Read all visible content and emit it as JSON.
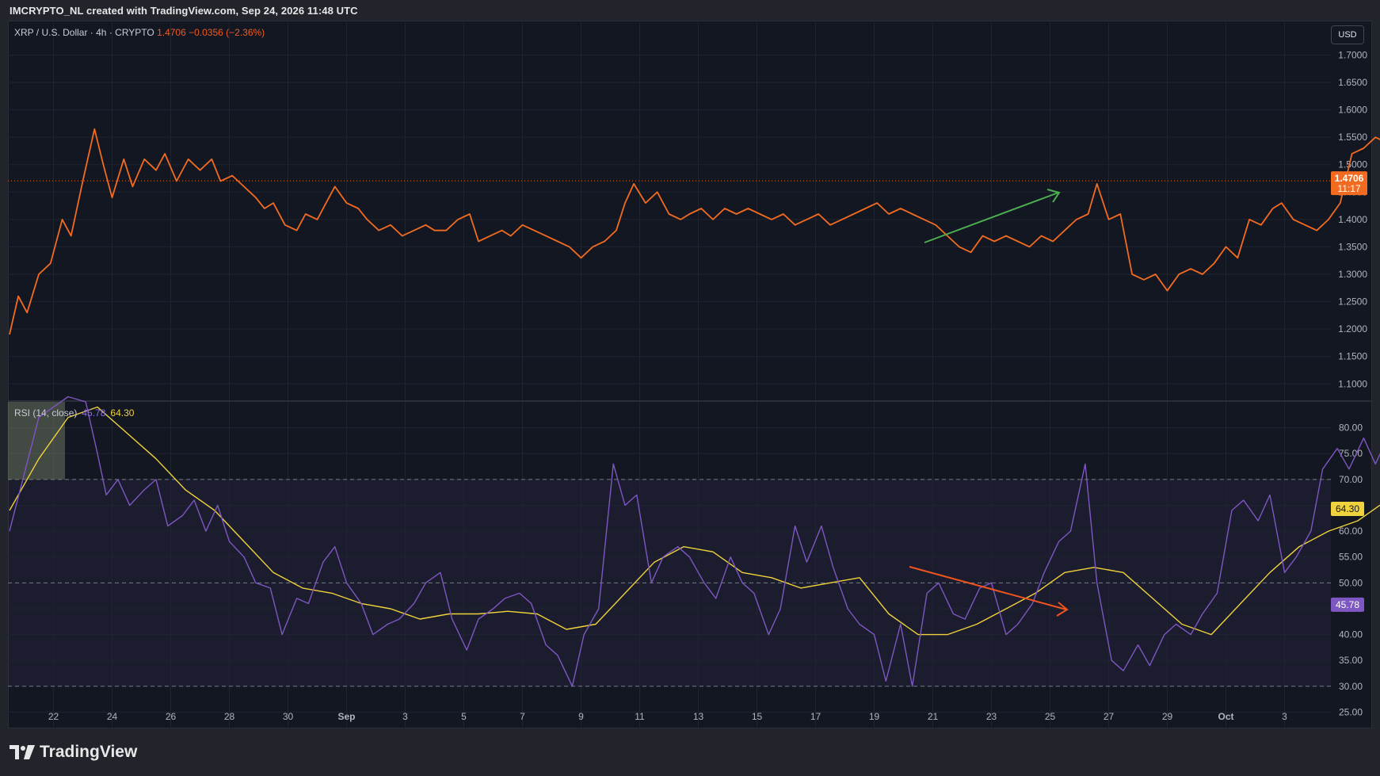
{
  "header": {
    "credit": "IMCRYPTO_NL created with TradingView.com, Sep 24, 2026 11:48 UTC",
    "symbol": "XRP / U.S. Dollar · 4h · CRYPTO",
    "last": "1.4706",
    "change": "−0.0356 (−2.36%)",
    "currency": "USD"
  },
  "rsi_header": {
    "label": "RSI (14, close)",
    "rsi_value": "45.78",
    "ma_value": "64.30"
  },
  "price_tag": {
    "price": "1.4706",
    "countdown": "11:17"
  },
  "brand": {
    "name": "TradingView"
  },
  "colors": {
    "price_line": "#f26b21",
    "rsi_line": "#7e57c2",
    "rsi_ma": "#f0d23c",
    "up_arrow": "#4caf50",
    "down_arrow": "#f0541e",
    "background": "#131722"
  },
  "chart_data": [
    {
      "type": "line",
      "name": "price",
      "ylim": [
        1.07,
        1.76
      ],
      "yticks": [
        "1.7000",
        "1.6500",
        "1.6000",
        "1.5500",
        "1.5000",
        "1.4500",
        "1.4000",
        "1.3500",
        "1.3000",
        "1.2500",
        "1.2000",
        "1.1500",
        "1.1000"
      ],
      "x_ticks": [
        "22",
        "24",
        "26",
        "28",
        "30",
        "Sep",
        "3",
        "5",
        "7",
        "9",
        "11",
        "13",
        "15",
        "17",
        "19",
        "21",
        "23",
        "25",
        "27",
        "29",
        "Oct",
        "3"
      ],
      "x_range": [
        0,
        44.5
      ],
      "points": [
        [
          0,
          1.19
        ],
        [
          0.3,
          1.26
        ],
        [
          0.6,
          1.23
        ],
        [
          1.0,
          1.3
        ],
        [
          1.4,
          1.32
        ],
        [
          1.8,
          1.4
        ],
        [
          2.1,
          1.37
        ],
        [
          2.5,
          1.47
        ],
        [
          2.9,
          1.565
        ],
        [
          3.2,
          1.5
        ],
        [
          3.5,
          1.44
        ],
        [
          3.9,
          1.51
        ],
        [
          4.2,
          1.46
        ],
        [
          4.6,
          1.51
        ],
        [
          5.0,
          1.49
        ],
        [
          5.3,
          1.52
        ],
        [
          5.7,
          1.47
        ],
        [
          6.1,
          1.51
        ],
        [
          6.5,
          1.49
        ],
        [
          6.9,
          1.51
        ],
        [
          7.2,
          1.47
        ],
        [
          7.6,
          1.48
        ],
        [
          8.0,
          1.46
        ],
        [
          8.4,
          1.44
        ],
        [
          8.7,
          1.42
        ],
        [
          9.0,
          1.43
        ],
        [
          9.4,
          1.39
        ],
        [
          9.8,
          1.38
        ],
        [
          10.1,
          1.41
        ],
        [
          10.5,
          1.4
        ],
        [
          10.8,
          1.43
        ],
        [
          11.1,
          1.46
        ],
        [
          11.5,
          1.43
        ],
        [
          11.9,
          1.42
        ],
        [
          12.2,
          1.4
        ],
        [
          12.6,
          1.38
        ],
        [
          13.0,
          1.39
        ],
        [
          13.4,
          1.37
        ],
        [
          13.8,
          1.38
        ],
        [
          14.2,
          1.39
        ],
        [
          14.5,
          1.38
        ],
        [
          14.9,
          1.38
        ],
        [
          15.3,
          1.4
        ],
        [
          15.7,
          1.41
        ],
        [
          16.0,
          1.36
        ],
        [
          16.4,
          1.37
        ],
        [
          16.8,
          1.38
        ],
        [
          17.1,
          1.37
        ],
        [
          17.5,
          1.39
        ],
        [
          17.9,
          1.38
        ],
        [
          18.3,
          1.37
        ],
        [
          18.7,
          1.36
        ],
        [
          19.1,
          1.35
        ],
        [
          19.5,
          1.33
        ],
        [
          19.9,
          1.35
        ],
        [
          20.3,
          1.36
        ],
        [
          20.7,
          1.38
        ],
        [
          21.0,
          1.43
        ],
        [
          21.3,
          1.465
        ],
        [
          21.7,
          1.43
        ],
        [
          22.1,
          1.45
        ],
        [
          22.5,
          1.41
        ],
        [
          22.9,
          1.4
        ],
        [
          23.2,
          1.41
        ],
        [
          23.6,
          1.42
        ],
        [
          24.0,
          1.4
        ],
        [
          24.4,
          1.42
        ],
        [
          24.8,
          1.41
        ],
        [
          25.2,
          1.42
        ],
        [
          25.6,
          1.41
        ],
        [
          26.0,
          1.4
        ],
        [
          26.4,
          1.41
        ],
        [
          26.8,
          1.39
        ],
        [
          27.2,
          1.4
        ],
        [
          27.6,
          1.41
        ],
        [
          28.0,
          1.39
        ],
        [
          28.4,
          1.4
        ],
        [
          28.8,
          1.41
        ],
        [
          29.2,
          1.42
        ],
        [
          29.6,
          1.43
        ],
        [
          30.0,
          1.41
        ],
        [
          30.4,
          1.42
        ],
        [
          30.8,
          1.41
        ],
        [
          31.2,
          1.4
        ],
        [
          31.6,
          1.39
        ],
        [
          32.0,
          1.37
        ],
        [
          32.4,
          1.35
        ],
        [
          32.8,
          1.34
        ],
        [
          33.2,
          1.37
        ],
        [
          33.6,
          1.36
        ],
        [
          34.0,
          1.37
        ],
        [
          34.4,
          1.36
        ],
        [
          34.8,
          1.35
        ],
        [
          35.2,
          1.37
        ],
        [
          35.6,
          1.36
        ],
        [
          36.0,
          1.38
        ],
        [
          36.4,
          1.4
        ],
        [
          36.8,
          1.41
        ],
        [
          37.1,
          1.465
        ],
        [
          37.5,
          1.4
        ],
        [
          37.9,
          1.41
        ],
        [
          38.3,
          1.3
        ],
        [
          38.7,
          1.29
        ],
        [
          39.1,
          1.3
        ],
        [
          39.5,
          1.27
        ],
        [
          39.9,
          1.3
        ],
        [
          40.3,
          1.31
        ],
        [
          40.7,
          1.3
        ],
        [
          41.1,
          1.32
        ],
        [
          41.5,
          1.35
        ],
        [
          41.9,
          1.33
        ],
        [
          42.3,
          1.4
        ],
        [
          42.7,
          1.39
        ],
        [
          43.1,
          1.42
        ],
        [
          43.4,
          1.43
        ],
        [
          43.8,
          1.4
        ],
        [
          44.2,
          1.39
        ],
        [
          44.6,
          1.38
        ],
        [
          45.0,
          1.4
        ],
        [
          45.4,
          1.43
        ],
        [
          45.8,
          1.52
        ],
        [
          46.2,
          1.53
        ],
        [
          46.6,
          1.55
        ],
        [
          47.0,
          1.54
        ],
        [
          47.3,
          1.59
        ],
        [
          47.7,
          1.57
        ],
        [
          48.1,
          1.62
        ],
        [
          48.5,
          1.58
        ],
        [
          48.9,
          1.51
        ],
        [
          49.3,
          1.5
        ],
        [
          49.7,
          1.505
        ],
        [
          50.0,
          1.49
        ],
        [
          50.3,
          1.4706
        ]
      ]
    },
    {
      "type": "line",
      "name": "RSI (14, close)",
      "ylim": [
        22,
        85
      ],
      "yticks": [
        "80.00",
        "75.00",
        "70.00",
        "65.00",
        "60.00",
        "55.00",
        "50.00",
        "45.00",
        "40.00",
        "35.00",
        "30.00",
        "25.00"
      ],
      "levels": [
        70,
        50,
        30
      ],
      "rsi_points": [
        [
          0,
          60
        ],
        [
          1.0,
          82
        ],
        [
          2.0,
          86
        ],
        [
          2.6,
          85
        ],
        [
          3.0,
          75
        ],
        [
          3.3,
          67
        ],
        [
          3.7,
          70
        ],
        [
          4.1,
          65
        ],
        [
          4.6,
          68
        ],
        [
          5.0,
          70
        ],
        [
          5.4,
          61
        ],
        [
          5.9,
          63
        ],
        [
          6.3,
          66
        ],
        [
          6.7,
          60
        ],
        [
          7.1,
          65
        ],
        [
          7.5,
          58
        ],
        [
          8.0,
          55
        ],
        [
          8.4,
          50
        ],
        [
          8.9,
          49
        ],
        [
          9.3,
          40
        ],
        [
          9.8,
          47
        ],
        [
          10.2,
          46
        ],
        [
          10.7,
          54
        ],
        [
          11.1,
          57
        ],
        [
          11.5,
          50
        ],
        [
          12.0,
          46
        ],
        [
          12.4,
          40
        ],
        [
          12.9,
          42
        ],
        [
          13.3,
          43
        ],
        [
          13.8,
          46
        ],
        [
          14.2,
          50
        ],
        [
          14.7,
          52
        ],
        [
          15.1,
          43
        ],
        [
          15.6,
          37
        ],
        [
          16.0,
          43
        ],
        [
          16.5,
          45
        ],
        [
          16.9,
          47
        ],
        [
          17.4,
          48
        ],
        [
          17.8,
          46
        ],
        [
          18.3,
          38
        ],
        [
          18.7,
          36
        ],
        [
          19.2,
          30
        ],
        [
          19.6,
          40
        ],
        [
          20.1,
          45
        ],
        [
          20.6,
          73
        ],
        [
          21.0,
          65
        ],
        [
          21.4,
          67
        ],
        [
          21.9,
          50
        ],
        [
          22.3,
          55
        ],
        [
          22.8,
          57
        ],
        [
          23.2,
          55
        ],
        [
          23.7,
          50
        ],
        [
          24.1,
          47
        ],
        [
          24.6,
          55
        ],
        [
          25.0,
          50
        ],
        [
          25.4,
          48
        ],
        [
          25.9,
          40
        ],
        [
          26.3,
          45
        ],
        [
          26.8,
          61
        ],
        [
          27.2,
          54
        ],
        [
          27.7,
          61
        ],
        [
          28.1,
          53
        ],
        [
          28.6,
          45
        ],
        [
          29.0,
          42
        ],
        [
          29.5,
          40
        ],
        [
          29.9,
          31
        ],
        [
          30.4,
          42
        ],
        [
          30.8,
          30
        ],
        [
          31.3,
          48
        ],
        [
          31.7,
          50
        ],
        [
          32.2,
          44
        ],
        [
          32.6,
          43
        ],
        [
          33.1,
          49
        ],
        [
          33.5,
          50
        ],
        [
          34.0,
          40
        ],
        [
          34.4,
          42
        ],
        [
          34.9,
          46
        ],
        [
          35.3,
          52
        ],
        [
          35.8,
          58
        ],
        [
          36.2,
          60
        ],
        [
          36.7,
          73
        ],
        [
          37.1,
          50
        ],
        [
          37.6,
          35
        ],
        [
          38.0,
          33
        ],
        [
          38.5,
          38
        ],
        [
          38.9,
          34
        ],
        [
          39.4,
          40
        ],
        [
          39.8,
          42
        ],
        [
          40.3,
          40
        ],
        [
          40.7,
          44
        ],
        [
          41.2,
          48
        ],
        [
          41.7,
          64
        ],
        [
          42.1,
          66
        ],
        [
          42.6,
          62
        ],
        [
          43.0,
          67
        ],
        [
          43.5,
          52
        ],
        [
          43.9,
          55
        ],
        [
          44.4,
          60
        ],
        [
          44.8,
          72
        ],
        [
          45.3,
          76
        ],
        [
          45.7,
          72
        ],
        [
          46.2,
          78
        ],
        [
          46.6,
          73
        ],
        [
          47.1,
          79
        ],
        [
          47.5,
          74
        ],
        [
          48.0,
          78
        ],
        [
          48.4,
          52
        ],
        [
          48.9,
          50
        ],
        [
          49.3,
          51
        ],
        [
          49.8,
          50
        ],
        [
          50.3,
          45.78
        ]
      ],
      "ma_points": [
        [
          0,
          64
        ],
        [
          1,
          74
        ],
        [
          2,
          82
        ],
        [
          3,
          84
        ],
        [
          4,
          79
        ],
        [
          5,
          74
        ],
        [
          6,
          68
        ],
        [
          7,
          64
        ],
        [
          8,
          58
        ],
        [
          9,
          52
        ],
        [
          10,
          49
        ],
        [
          11,
          48
        ],
        [
          12,
          46
        ],
        [
          13,
          45
        ],
        [
          14,
          43
        ],
        [
          15,
          44
        ],
        [
          16,
          44
        ],
        [
          17,
          44.5
        ],
        [
          18,
          44
        ],
        [
          19,
          41
        ],
        [
          20,
          42
        ],
        [
          21,
          48
        ],
        [
          22,
          54
        ],
        [
          23,
          57
        ],
        [
          24,
          56
        ],
        [
          25,
          52
        ],
        [
          26,
          51
        ],
        [
          27,
          49
        ],
        [
          28,
          50
        ],
        [
          29,
          51
        ],
        [
          30,
          44
        ],
        [
          31,
          40
        ],
        [
          32,
          40
        ],
        [
          33,
          42
        ],
        [
          34,
          45
        ],
        [
          35,
          48
        ],
        [
          36,
          52
        ],
        [
          37,
          53
        ],
        [
          38,
          52
        ],
        [
          39,
          47
        ],
        [
          40,
          42
        ],
        [
          41,
          40
        ],
        [
          42,
          46
        ],
        [
          43,
          52
        ],
        [
          44,
          57
        ],
        [
          45,
          60
        ],
        [
          46,
          62
        ],
        [
          47,
          66
        ],
        [
          48,
          74
        ],
        [
          49,
          70
        ],
        [
          50.3,
          64.3
        ]
      ]
    }
  ]
}
